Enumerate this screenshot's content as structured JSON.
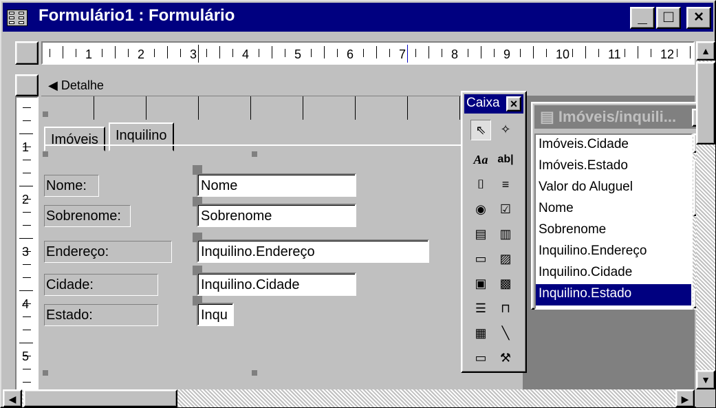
{
  "window": {
    "title": "Formulário1 : Formulário",
    "minimize_label": "_",
    "maximize_label": "□",
    "close_label": "×"
  },
  "ruler": {
    "horizontal_numbers": [
      "1",
      "2",
      "3",
      "4",
      "5",
      "6",
      "7",
      "8",
      "9",
      "10",
      "11",
      "12"
    ],
    "vertical_numbers": [
      "1",
      "2",
      "3",
      "4",
      "5"
    ]
  },
  "section": {
    "label": "Detalhe",
    "icon": "down-triangle-icon"
  },
  "tabs": [
    {
      "label": "Imóveis",
      "active": false
    },
    {
      "label": "Inquilino",
      "active": true
    }
  ],
  "fields": [
    {
      "label": "Nome:",
      "value": "Nome"
    },
    {
      "label": "Sobrenome:",
      "value": "Sobrenome"
    },
    {
      "label": "Endereço:",
      "value": "Inquilino.Endereço"
    },
    {
      "label": "Cidade:",
      "value": "Inquilino.Cidade"
    },
    {
      "label": "Estado:",
      "value": "Inqu"
    }
  ],
  "toolbox": {
    "title": "Caixa",
    "close_label": "×",
    "tools": [
      {
        "name": "select-objects-icon",
        "glyph": "⇖"
      },
      {
        "name": "control-wizards-icon",
        "glyph": "✧"
      },
      {
        "name": "label-tool-icon",
        "glyph": "Aa"
      },
      {
        "name": "text-box-tool-icon",
        "glyph": "ab|"
      },
      {
        "name": "option-group-tool-icon",
        "glyph": "⌷"
      },
      {
        "name": "toggle-button-tool-icon",
        "glyph": "≡"
      },
      {
        "name": "option-button-tool-icon",
        "glyph": "◉"
      },
      {
        "name": "check-box-tool-icon",
        "glyph": "☑"
      },
      {
        "name": "combo-box-tool-icon",
        "glyph": "▤"
      },
      {
        "name": "list-box-tool-icon",
        "glyph": "▥"
      },
      {
        "name": "command-button-tool-icon",
        "glyph": "▭"
      },
      {
        "name": "image-tool-icon",
        "glyph": "▨"
      },
      {
        "name": "unbound-object-frame-tool-icon",
        "glyph": "▣"
      },
      {
        "name": "bound-object-frame-tool-icon",
        "glyph": "▩"
      },
      {
        "name": "page-break-tool-icon",
        "glyph": "☰"
      },
      {
        "name": "tab-control-tool-icon",
        "glyph": "⊓"
      },
      {
        "name": "subform-tool-icon",
        "glyph": "▦"
      },
      {
        "name": "line-tool-icon",
        "glyph": "╲"
      },
      {
        "name": "rectangle-tool-icon",
        "glyph": "▭"
      },
      {
        "name": "more-controls-icon",
        "glyph": "⚒"
      }
    ]
  },
  "field_list": {
    "title": "Imóveis/inquili...",
    "close_label": "×",
    "items": [
      "Imóveis.Cidade",
      "Imóveis.Estado",
      "Valor do Aluguel",
      "Nome",
      "Sobrenome",
      "Inquilino.Endereço",
      "Inquilino.Cidade",
      "Inquilino.Estado"
    ],
    "selected_index": 7
  },
  "colors": {
    "title_active": "#000080",
    "title_inactive": "#808080",
    "face": "#c0c0c0",
    "selection": "#000080"
  }
}
